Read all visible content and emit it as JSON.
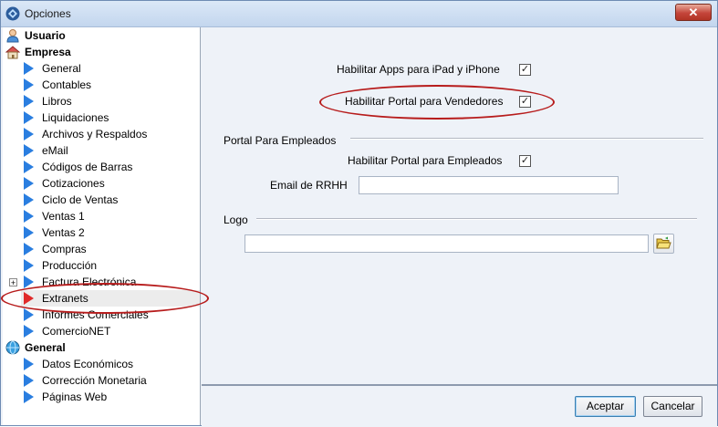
{
  "window": {
    "title": "Opciones",
    "close_label": "✕"
  },
  "tree": {
    "usuario": "Usuario",
    "empresa": "Empresa",
    "empresa_items": [
      "General",
      "Contables",
      "Libros",
      "Liquidaciones",
      "Archivos y Respaldos",
      "eMail",
      "Códigos de Barras",
      "Cotizaciones",
      "Ciclo de Ventas",
      "Ventas 1",
      "Ventas 2",
      "Compras",
      "Producción",
      "Factura Electrónica",
      "Extranets",
      "Informes Comerciales",
      "ComercioNET"
    ],
    "general": "General",
    "general_items": [
      "Datos Económicos",
      "Corrección Monetaria",
      "Páginas Web"
    ],
    "selected": "Extranets"
  },
  "content": {
    "apps_label": "Habilitar Apps para iPad y iPhone",
    "portal_vendedores_label": "Habilitar Portal para Vendedores",
    "portal_empleados_section": "Portal Para Empleados",
    "portal_empleados_label": "Habilitar Portal para Empleados",
    "email_rrhh_label": "Email de RRHH",
    "email_rrhh_value": "",
    "logo_section": "Logo",
    "logo_path_value": "",
    "check_mark": "✓"
  },
  "buttons": {
    "accept": "Aceptar",
    "cancel": "Cancelar"
  }
}
